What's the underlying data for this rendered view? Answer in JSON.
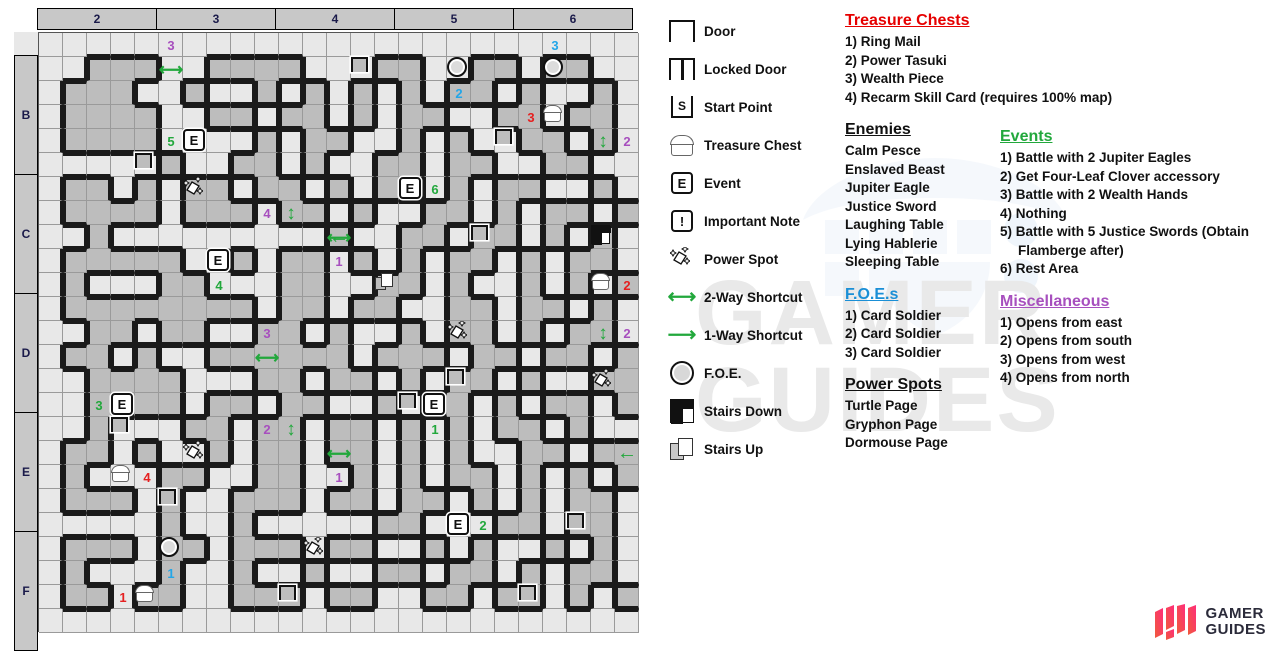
{
  "map": {
    "column_headers": [
      "2",
      "3",
      "4",
      "5",
      "6"
    ],
    "row_headers": [
      "B",
      "C",
      "D",
      "E",
      "F"
    ],
    "grid_cols": 25,
    "grid_rows": 25
  },
  "legend": {
    "items": [
      {
        "icon": "door-icon",
        "label": "Door"
      },
      {
        "icon": "locked-door-icon",
        "label": "Locked Door"
      },
      {
        "icon": "start-point-icon",
        "label": "Start Point"
      },
      {
        "icon": "treasure-chest-icon",
        "label": "Treasure Chest"
      },
      {
        "icon": "event-icon",
        "label": "Event"
      },
      {
        "icon": "important-note-icon",
        "label": "Important Note"
      },
      {
        "icon": "power-spot-icon",
        "label": "Power Spot"
      },
      {
        "icon": "two-way-shortcut-icon",
        "label": "2-Way Shortcut"
      },
      {
        "icon": "one-way-shortcut-icon",
        "label": "1-Way Shortcut"
      },
      {
        "icon": "foe-icon",
        "label": "F.O.E."
      },
      {
        "icon": "stairs-down-icon",
        "label": "Stairs Down"
      },
      {
        "icon": "stairs-up-icon",
        "label": "Stairs Up"
      }
    ],
    "start_point_letter": "S",
    "event_letter": "E",
    "important_note_glyph": "!"
  },
  "sections": {
    "treasure_chests": {
      "title": "Treasure Chests",
      "color": "#e60000",
      "items": [
        "1) Ring Mail",
        "2) Power Tasuki",
        "3) Wealth Piece",
        "4) Recarm Skill Card (requires 100% map)"
      ]
    },
    "enemies": {
      "title": "Enemies",
      "color": "#111111",
      "items": [
        "Calm Pesce",
        "Enslaved Beast",
        "Jupiter Eagle",
        "Justice Sword",
        "Laughing Table",
        "Lying Hablerie",
        "Sleeping Table"
      ]
    },
    "foes": {
      "title": "F.O.E.s",
      "color": "#1a8fd6",
      "items": [
        "1) Card Soldier",
        "2) Card Soldier",
        "3) Card Soldier"
      ]
    },
    "power_spots": {
      "title": "Power Spots",
      "color": "#111111",
      "items": [
        "Turtle Page",
        "Gryphon Page",
        "Dormouse Page"
      ]
    },
    "events": {
      "title": "Events",
      "color": "#22a83c",
      "items": [
        "1) Battle with 2 Jupiter Eagles",
        "2) Get Four-Leaf Clover accessory",
        "3) Battle with 2 Wealth Hands",
        "4) Nothing",
        "5) Battle with 5 Justice Swords (Obtain",
        "Flamberge after)",
        "6) Rest Area"
      ]
    },
    "miscellaneous": {
      "title": "Miscellaneous",
      "color": "#a74fbe",
      "items": [
        "1) Opens from east",
        "2) Opens from south",
        "3) Opens from west",
        "4) Opens from north"
      ]
    }
  },
  "markers": [
    {
      "type": "num",
      "color": "purple",
      "text": "3",
      "col": 5,
      "row": 0
    },
    {
      "type": "arrow2h",
      "col": 5,
      "row": 1
    },
    {
      "type": "num",
      "color": "green",
      "text": "5",
      "col": 5,
      "row": 4
    },
    {
      "type": "event",
      "text": "E",
      "col": 6,
      "row": 4
    },
    {
      "type": "door",
      "orient": "v",
      "col": 4,
      "row": 5
    },
    {
      "type": "pspot",
      "col": 6,
      "row": 6
    },
    {
      "type": "num",
      "color": "purple",
      "text": "4",
      "col": 9,
      "row": 7
    },
    {
      "type": "arrow2v",
      "col": 10,
      "row": 7
    },
    {
      "type": "arrow1l",
      "col": 12,
      "row": 8
    },
    {
      "type": "event",
      "text": "E",
      "col": 7,
      "row": 9
    },
    {
      "type": "num",
      "color": "green",
      "text": "4",
      "col": 7,
      "row": 10
    },
    {
      "type": "num",
      "color": "blue",
      "text": "3",
      "col": 21,
      "row": 0
    },
    {
      "type": "foe",
      "col": 17,
      "row": 1
    },
    {
      "type": "foe",
      "col": 21,
      "row": 1
    },
    {
      "type": "door",
      "orient": "v",
      "col": 13,
      "row": 1
    },
    {
      "type": "num",
      "color": "blue",
      "text": "2",
      "col": 17,
      "row": 2
    },
    {
      "type": "num",
      "color": "red",
      "text": "3",
      "col": 20,
      "row": 3
    },
    {
      "type": "chest",
      "col": 21,
      "row": 3
    },
    {
      "type": "door",
      "orient": "v",
      "col": 19,
      "row": 4
    },
    {
      "type": "arrow2v",
      "col": 23,
      "row": 4
    },
    {
      "type": "num",
      "color": "purple",
      "text": "2",
      "col": 24,
      "row": 4
    },
    {
      "type": "event",
      "text": "E",
      "col": 15,
      "row": 6
    },
    {
      "type": "num",
      "color": "green",
      "text": "6",
      "col": 16,
      "row": 6
    },
    {
      "type": "arrow2h",
      "col": 12,
      "row": 8
    },
    {
      "type": "door",
      "orient": "v",
      "col": 18,
      "row": 8
    },
    {
      "type": "stairsdown",
      "col": 23,
      "row": 8
    },
    {
      "type": "num",
      "color": "purple",
      "text": "1",
      "col": 12,
      "row": 9
    },
    {
      "type": "stairsup",
      "col": 14,
      "row": 10
    },
    {
      "type": "chest",
      "col": 23,
      "row": 10
    },
    {
      "type": "num",
      "color": "red",
      "text": "2",
      "col": 24,
      "row": 10
    },
    {
      "type": "num",
      "color": "purple",
      "text": "3",
      "col": 9,
      "row": 12
    },
    {
      "type": "arrow2h",
      "col": 9,
      "row": 13
    },
    {
      "type": "pspot",
      "col": 17,
      "row": 12
    },
    {
      "type": "arrow2v",
      "col": 23,
      "row": 12
    },
    {
      "type": "num",
      "color": "purple",
      "text": "2",
      "col": 24,
      "row": 12
    },
    {
      "type": "door",
      "orient": "v",
      "col": 17,
      "row": 14
    },
    {
      "type": "pspot",
      "col": 23,
      "row": 14
    },
    {
      "type": "num",
      "color": "green",
      "text": "3",
      "col": 2,
      "row": 15
    },
    {
      "type": "event",
      "text": "E",
      "col": 3,
      "row": 15
    },
    {
      "type": "door",
      "orient": "v",
      "col": 15,
      "row": 15
    },
    {
      "type": "event",
      "text": "E",
      "col": 16,
      "row": 15
    },
    {
      "type": "door",
      "orient": "v",
      "col": 3,
      "row": 16
    },
    {
      "type": "num",
      "color": "purple",
      "text": "2",
      "col": 9,
      "row": 16
    },
    {
      "type": "arrow2v",
      "col": 10,
      "row": 16
    },
    {
      "type": "num",
      "color": "green",
      "text": "1",
      "col": 16,
      "row": 16
    },
    {
      "type": "pspot",
      "col": 6,
      "row": 17
    },
    {
      "type": "arrow2h",
      "col": 12,
      "row": 17
    },
    {
      "type": "arrow1l",
      "col": 24,
      "row": 17
    },
    {
      "type": "chest",
      "col": 3,
      "row": 18
    },
    {
      "type": "num",
      "color": "red",
      "text": "4",
      "col": 4,
      "row": 18
    },
    {
      "type": "num",
      "color": "purple",
      "text": "1",
      "col": 12,
      "row": 18
    },
    {
      "type": "door",
      "orient": "v",
      "col": 5,
      "row": 19
    },
    {
      "type": "event",
      "text": "E",
      "col": 17,
      "row": 20
    },
    {
      "type": "num",
      "color": "green",
      "text": "2",
      "col": 18,
      "row": 20
    },
    {
      "type": "door",
      "orient": "v",
      "col": 22,
      "row": 20
    },
    {
      "type": "foe",
      "col": 5,
      "row": 21
    },
    {
      "type": "pspot",
      "col": 11,
      "row": 21
    },
    {
      "type": "num",
      "color": "blue",
      "text": "1",
      "col": 5,
      "row": 22
    },
    {
      "type": "num",
      "color": "red",
      "text": "1",
      "col": 3,
      "row": 23
    },
    {
      "type": "chest",
      "col": 4,
      "row": 23
    },
    {
      "type": "door",
      "orient": "v",
      "col": 10,
      "row": 23
    },
    {
      "type": "door",
      "orient": "v",
      "col": 20,
      "row": 23
    }
  ],
  "filled_cells": "see generator",
  "logo": {
    "line1": "GAMER",
    "line2": "GUIDES"
  },
  "watermark": {
    "text1": "GAMER",
    "text2": "GUIDES"
  }
}
